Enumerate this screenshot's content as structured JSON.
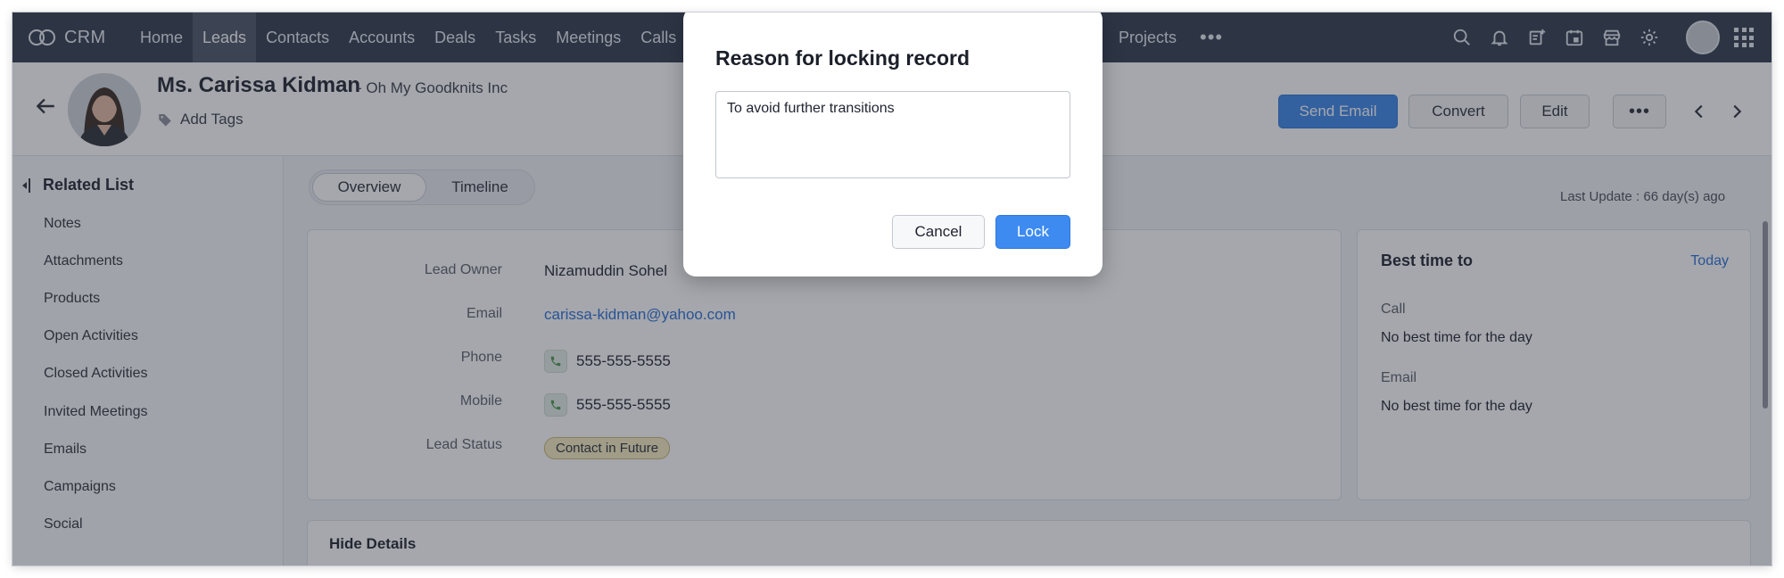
{
  "topnav": {
    "brand": "CRM",
    "items": [
      {
        "label": "Home",
        "active": false
      },
      {
        "label": "Leads",
        "active": true
      },
      {
        "label": "Contacts",
        "active": false
      },
      {
        "label": "Accounts",
        "active": false
      },
      {
        "label": "Deals",
        "active": false
      },
      {
        "label": "Tasks",
        "active": false
      },
      {
        "label": "Meetings",
        "active": false
      },
      {
        "label": "Calls",
        "active": false
      }
    ],
    "projects": "Projects",
    "more": "•••",
    "icons": [
      "search-icon",
      "bell-icon",
      "add-note-icon",
      "calendar-icon",
      "marketplace-icon",
      "settings-gear-icon",
      "user-avatar",
      "apps-grid-icon"
    ]
  },
  "header": {
    "name": "Ms. Carissa Kidman",
    "company": "- Oh My Goodknits Inc",
    "add_tags": "Add Tags",
    "buttons": {
      "send_email": "Send Email",
      "convert": "Convert",
      "edit": "Edit",
      "more": "•••"
    }
  },
  "sidebar": {
    "title": "Related List",
    "items": [
      "Notes",
      "Attachments",
      "Products",
      "Open Activities",
      "Closed Activities",
      "Invited Meetings",
      "Emails",
      "Campaigns",
      "Social"
    ]
  },
  "tabs": {
    "overview": "Overview",
    "timeline": "Timeline",
    "active": "Overview"
  },
  "last_update": "Last Update : 66 day(s) ago",
  "lead_details": {
    "rows": [
      {
        "label": "Lead Owner",
        "value": "Nizamuddin Sohel"
      },
      {
        "label": "Email",
        "value": "carissa-kidman@yahoo.com"
      },
      {
        "label": "Phone",
        "value": "555-555-5555"
      },
      {
        "label": "Mobile",
        "value": "555-555-5555"
      },
      {
        "label": "Lead Status",
        "value": "Contact in Future"
      }
    ]
  },
  "best_time": {
    "title": "Best time to",
    "today": "Today",
    "call_label": "Call",
    "call_value": "No best time for the day",
    "email_label": "Email",
    "email_value": "No best time for the day"
  },
  "hide_details": "Hide Details",
  "modal": {
    "title": "Reason for locking record",
    "reason_value": "To avoid further transitions",
    "cancel": "Cancel",
    "lock": "Lock"
  },
  "colors": {
    "nav_bg": "#313c4f",
    "primary_blue": "#3b86e8",
    "link_blue": "#2b6fd6",
    "status_badge": "#f7ecbf"
  }
}
